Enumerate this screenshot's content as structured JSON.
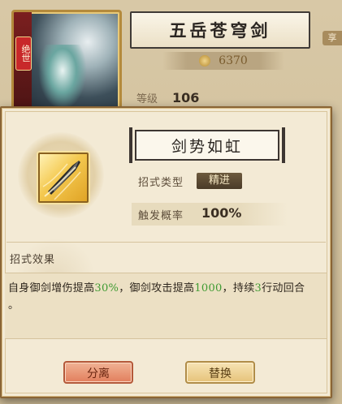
{
  "background": {
    "card_badge": "绝世",
    "title": "五岳苍穹剑",
    "power_value": "6370",
    "level_label": "等级",
    "level_value": "106",
    "side_tag": "享"
  },
  "popup": {
    "skill_name": "剑势如虹",
    "type_label": "招式类型",
    "type_value": "精进",
    "rate_label": "触发概率",
    "rate_value": "100%",
    "effect_header": "招式效果",
    "effect": {
      "p1": "自身御剑增伤提高",
      "v1": "30%",
      "p2": "，御剑攻击提高",
      "v2": "1000",
      "p3": "，持续",
      "v3": "3",
      "p4": "行动回合",
      "end": "。"
    },
    "buttons": {
      "separate": "分离",
      "replace": "替换"
    }
  },
  "colors": {
    "highlight_green": "#3f9b32",
    "separate_button": "#e27f5d",
    "replace_button": "#e6c37a"
  },
  "icons": [
    "sword-tip-icon",
    "coin-icon"
  ]
}
